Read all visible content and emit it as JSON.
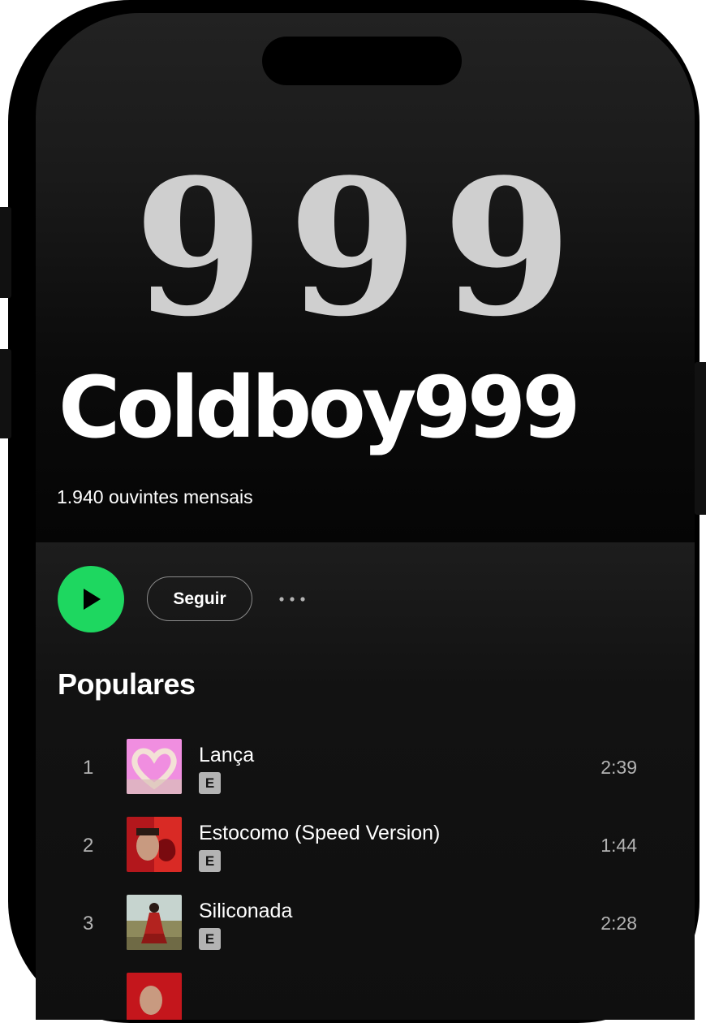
{
  "artist": {
    "logo_text": "999",
    "name": "Coldboy999",
    "monthly_listeners": "1.940 ouvintes mensais"
  },
  "actions": {
    "play_icon": "play-icon",
    "follow_label": "Seguir",
    "more_icon": "more-horizontal-icon"
  },
  "popular": {
    "title": "Populares",
    "tracks": [
      {
        "rank": "1",
        "title": "Lança",
        "explicit_label": "E",
        "duration": "2:39"
      },
      {
        "rank": "2",
        "title": "Estocomo (Speed Version)",
        "explicit_label": "E",
        "duration": "1:44"
      },
      {
        "rank": "3",
        "title": "Siliconada",
        "explicit_label": "E",
        "duration": "2:28"
      }
    ]
  },
  "colors": {
    "accent_green": "#1ed760",
    "background": "#121212",
    "text_secondary": "#b3b3b3"
  }
}
